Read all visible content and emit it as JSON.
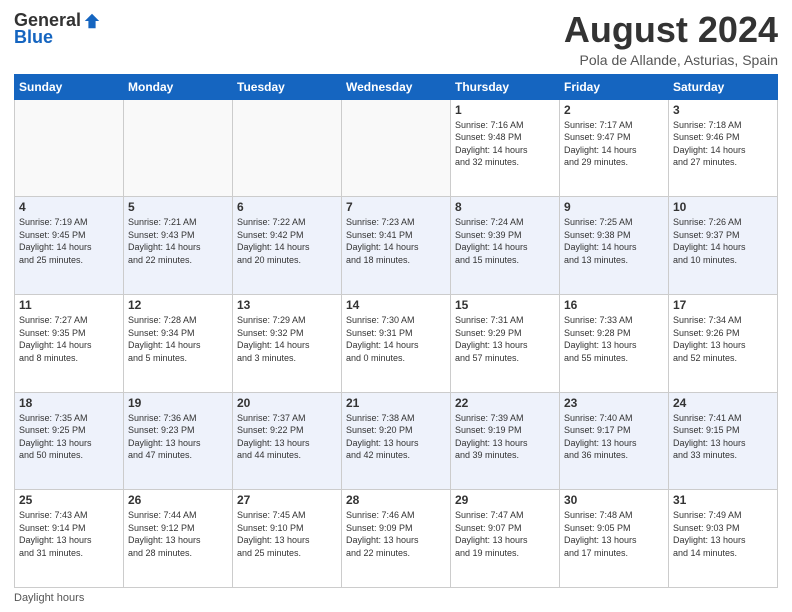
{
  "logo": {
    "general": "General",
    "blue": "Blue"
  },
  "title": {
    "month_year": "August 2024",
    "location": "Pola de Allande, Asturias, Spain"
  },
  "days_of_week": [
    "Sunday",
    "Monday",
    "Tuesday",
    "Wednesday",
    "Thursday",
    "Friday",
    "Saturday"
  ],
  "weeks": [
    [
      {
        "day": "",
        "info": ""
      },
      {
        "day": "",
        "info": ""
      },
      {
        "day": "",
        "info": ""
      },
      {
        "day": "",
        "info": ""
      },
      {
        "day": "1",
        "info": "Sunrise: 7:16 AM\nSunset: 9:48 PM\nDaylight: 14 hours\nand 32 minutes."
      },
      {
        "day": "2",
        "info": "Sunrise: 7:17 AM\nSunset: 9:47 PM\nDaylight: 14 hours\nand 29 minutes."
      },
      {
        "day": "3",
        "info": "Sunrise: 7:18 AM\nSunset: 9:46 PM\nDaylight: 14 hours\nand 27 minutes."
      }
    ],
    [
      {
        "day": "4",
        "info": "Sunrise: 7:19 AM\nSunset: 9:45 PM\nDaylight: 14 hours\nand 25 minutes."
      },
      {
        "day": "5",
        "info": "Sunrise: 7:21 AM\nSunset: 9:43 PM\nDaylight: 14 hours\nand 22 minutes."
      },
      {
        "day": "6",
        "info": "Sunrise: 7:22 AM\nSunset: 9:42 PM\nDaylight: 14 hours\nand 20 minutes."
      },
      {
        "day": "7",
        "info": "Sunrise: 7:23 AM\nSunset: 9:41 PM\nDaylight: 14 hours\nand 18 minutes."
      },
      {
        "day": "8",
        "info": "Sunrise: 7:24 AM\nSunset: 9:39 PM\nDaylight: 14 hours\nand 15 minutes."
      },
      {
        "day": "9",
        "info": "Sunrise: 7:25 AM\nSunset: 9:38 PM\nDaylight: 14 hours\nand 13 minutes."
      },
      {
        "day": "10",
        "info": "Sunrise: 7:26 AM\nSunset: 9:37 PM\nDaylight: 14 hours\nand 10 minutes."
      }
    ],
    [
      {
        "day": "11",
        "info": "Sunrise: 7:27 AM\nSunset: 9:35 PM\nDaylight: 14 hours\nand 8 minutes."
      },
      {
        "day": "12",
        "info": "Sunrise: 7:28 AM\nSunset: 9:34 PM\nDaylight: 14 hours\nand 5 minutes."
      },
      {
        "day": "13",
        "info": "Sunrise: 7:29 AM\nSunset: 9:32 PM\nDaylight: 14 hours\nand 3 minutes."
      },
      {
        "day": "14",
        "info": "Sunrise: 7:30 AM\nSunset: 9:31 PM\nDaylight: 14 hours\nand 0 minutes."
      },
      {
        "day": "15",
        "info": "Sunrise: 7:31 AM\nSunset: 9:29 PM\nDaylight: 13 hours\nand 57 minutes."
      },
      {
        "day": "16",
        "info": "Sunrise: 7:33 AM\nSunset: 9:28 PM\nDaylight: 13 hours\nand 55 minutes."
      },
      {
        "day": "17",
        "info": "Sunrise: 7:34 AM\nSunset: 9:26 PM\nDaylight: 13 hours\nand 52 minutes."
      }
    ],
    [
      {
        "day": "18",
        "info": "Sunrise: 7:35 AM\nSunset: 9:25 PM\nDaylight: 13 hours\nand 50 minutes."
      },
      {
        "day": "19",
        "info": "Sunrise: 7:36 AM\nSunset: 9:23 PM\nDaylight: 13 hours\nand 47 minutes."
      },
      {
        "day": "20",
        "info": "Sunrise: 7:37 AM\nSunset: 9:22 PM\nDaylight: 13 hours\nand 44 minutes."
      },
      {
        "day": "21",
        "info": "Sunrise: 7:38 AM\nSunset: 9:20 PM\nDaylight: 13 hours\nand 42 minutes."
      },
      {
        "day": "22",
        "info": "Sunrise: 7:39 AM\nSunset: 9:19 PM\nDaylight: 13 hours\nand 39 minutes."
      },
      {
        "day": "23",
        "info": "Sunrise: 7:40 AM\nSunset: 9:17 PM\nDaylight: 13 hours\nand 36 minutes."
      },
      {
        "day": "24",
        "info": "Sunrise: 7:41 AM\nSunset: 9:15 PM\nDaylight: 13 hours\nand 33 minutes."
      }
    ],
    [
      {
        "day": "25",
        "info": "Sunrise: 7:43 AM\nSunset: 9:14 PM\nDaylight: 13 hours\nand 31 minutes."
      },
      {
        "day": "26",
        "info": "Sunrise: 7:44 AM\nSunset: 9:12 PM\nDaylight: 13 hours\nand 28 minutes."
      },
      {
        "day": "27",
        "info": "Sunrise: 7:45 AM\nSunset: 9:10 PM\nDaylight: 13 hours\nand 25 minutes."
      },
      {
        "day": "28",
        "info": "Sunrise: 7:46 AM\nSunset: 9:09 PM\nDaylight: 13 hours\nand 22 minutes."
      },
      {
        "day": "29",
        "info": "Sunrise: 7:47 AM\nSunset: 9:07 PM\nDaylight: 13 hours\nand 19 minutes."
      },
      {
        "day": "30",
        "info": "Sunrise: 7:48 AM\nSunset: 9:05 PM\nDaylight: 13 hours\nand 17 minutes."
      },
      {
        "day": "31",
        "info": "Sunrise: 7:49 AM\nSunset: 9:03 PM\nDaylight: 13 hours\nand 14 minutes."
      }
    ]
  ],
  "footer": {
    "daylight_label": "Daylight hours"
  }
}
